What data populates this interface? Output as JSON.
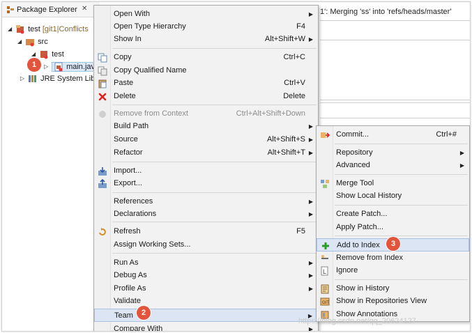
{
  "package_explorer": {
    "tab_title": "Package Explorer",
    "close_glyph": "✕",
    "tree": [
      {
        "label": "test",
        "decor": "[git1|Conflicts"
      },
      {
        "label": "src"
      },
      {
        "label": "test"
      },
      {
        "label": "main.java"
      },
      {
        "label": "JRE System Libr"
      }
    ]
  },
  "editor": {
    "tab_text": "1': Merging 'ss' into 'refs/heads/master'"
  },
  "context_menu": {
    "items": [
      {
        "label": "Open With",
        "shortcut": "",
        "submenu": true
      },
      {
        "label": "Open Type Hierarchy",
        "shortcut": "F4"
      },
      {
        "label": "Show In",
        "shortcut": "Alt+Shift+W",
        "submenu": true
      },
      {
        "label": "Copy",
        "shortcut": "Ctrl+C",
        "icon": "copy-icon"
      },
      {
        "label": "Copy Qualified Name",
        "shortcut": "",
        "icon": "copy-qualified-icon"
      },
      {
        "label": "Paste",
        "shortcut": "Ctrl+V",
        "icon": "paste-icon"
      },
      {
        "label": "Delete",
        "shortcut": "Delete",
        "icon": "delete-icon"
      },
      {
        "label": "Remove from Context",
        "shortcut": "Ctrl+Alt+Shift+Down",
        "icon": "remove-context-icon",
        "disabled": true
      },
      {
        "label": "Build Path",
        "shortcut": "",
        "submenu": true
      },
      {
        "label": "Source",
        "shortcut": "Alt+Shift+S",
        "submenu": true
      },
      {
        "label": "Refactor",
        "shortcut": "Alt+Shift+T",
        "submenu": true
      },
      {
        "label": "Import...",
        "shortcut": "",
        "icon": "import-icon"
      },
      {
        "label": "Export...",
        "shortcut": "",
        "icon": "export-icon"
      },
      {
        "label": "References",
        "shortcut": "",
        "submenu": true
      },
      {
        "label": "Declarations",
        "shortcut": "",
        "submenu": true
      },
      {
        "label": "Refresh",
        "shortcut": "F5",
        "icon": "refresh-icon"
      },
      {
        "label": "Assign Working Sets...",
        "shortcut": ""
      },
      {
        "label": "Run As",
        "shortcut": "",
        "submenu": true
      },
      {
        "label": "Debug As",
        "shortcut": "",
        "submenu": true
      },
      {
        "label": "Profile As",
        "shortcut": "",
        "submenu": true
      },
      {
        "label": "Validate",
        "shortcut": ""
      },
      {
        "label": "Team",
        "shortcut": "",
        "submenu": true,
        "highlighted": true
      },
      {
        "label": "Compare With",
        "shortcut": "",
        "submenu": true
      }
    ]
  },
  "team_submenu": {
    "items": [
      {
        "label": "Commit...",
        "shortcut": "Ctrl+#",
        "icon": "commit-icon"
      },
      {
        "label": "Repository",
        "shortcut": "",
        "submenu": true
      },
      {
        "label": "Advanced",
        "shortcut": "",
        "submenu": true
      },
      {
        "label": "Merge Tool",
        "shortcut": "",
        "icon": "merge-tool-icon"
      },
      {
        "label": "Show Local History",
        "shortcut": ""
      },
      {
        "label": "Create Patch...",
        "shortcut": ""
      },
      {
        "label": "Apply Patch...",
        "shortcut": ""
      },
      {
        "label": "Add to Index",
        "shortcut": "",
        "icon": "add-icon",
        "highlighted": true
      },
      {
        "label": "Remove from Index",
        "shortcut": "",
        "icon": "remove-index-icon"
      },
      {
        "label": "Ignore",
        "shortcut": "",
        "icon": "ignore-icon"
      },
      {
        "label": "Show in History",
        "shortcut": "",
        "icon": "history-icon"
      },
      {
        "label": "Show in Repositories View",
        "shortcut": "",
        "icon": "repositories-icon"
      },
      {
        "label": "Show Annotations",
        "shortcut": "",
        "icon": "annotations-icon"
      }
    ]
  },
  "badges": [
    "1",
    "2",
    "3"
  ],
  "watermark": "https://blog.csdn.net/qq_20624127",
  "colors": {
    "highlight": "#dbe5f3",
    "badge": "#e2553c"
  }
}
